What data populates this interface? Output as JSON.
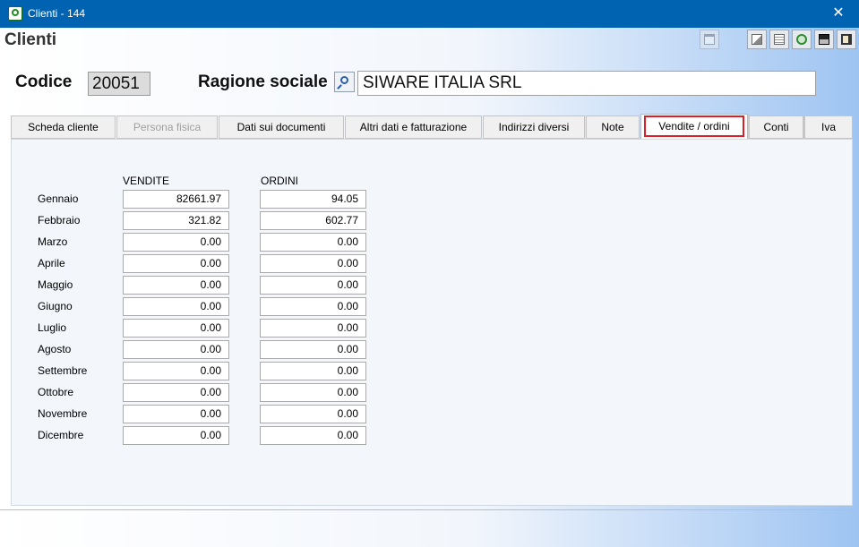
{
  "window": {
    "title": "Clienti - 144",
    "close_glyph": "✕"
  },
  "form": {
    "title": "Clienti"
  },
  "toolbar": {
    "icons": [
      "document-icon",
      "edit-icon",
      "notes-icon",
      "recycle-icon",
      "save-icon",
      "exit-icon"
    ]
  },
  "header": {
    "codice_label": "Codice",
    "codice_value": "20051",
    "ragione_label": "Ragione sociale",
    "ragione_value": "SIWARE ITALIA SRL"
  },
  "tabs": [
    {
      "label": "Scheda cliente",
      "state": "normal"
    },
    {
      "label": "Persona fisica",
      "state": "disabled"
    },
    {
      "label": "Dati sui documenti",
      "state": "normal"
    },
    {
      "label": "Altri dati e fatturazione",
      "state": "normal"
    },
    {
      "label": "Indirizzi diversi",
      "state": "normal"
    },
    {
      "label": "Note",
      "state": "normal"
    },
    {
      "label": "Vendite / ordini",
      "state": "active"
    },
    {
      "label": "Conti",
      "state": "normal"
    },
    {
      "label": "Iva",
      "state": "normal"
    }
  ],
  "sales": {
    "col_vendite": "VENDITE",
    "col_ordini": "ORDINI",
    "rows": [
      {
        "month": "Gennaio",
        "vendite": "82661.97",
        "ordini": "94.05"
      },
      {
        "month": "Febbraio",
        "vendite": "321.82",
        "ordini": "602.77"
      },
      {
        "month": "Marzo",
        "vendite": "0.00",
        "ordini": "0.00"
      },
      {
        "month": "Aprile",
        "vendite": "0.00",
        "ordini": "0.00"
      },
      {
        "month": "Maggio",
        "vendite": "0.00",
        "ordini": "0.00"
      },
      {
        "month": "Giugno",
        "vendite": "0.00",
        "ordini": "0.00"
      },
      {
        "month": "Luglio",
        "vendite": "0.00",
        "ordini": "0.00"
      },
      {
        "month": "Agosto",
        "vendite": "0.00",
        "ordini": "0.00"
      },
      {
        "month": "Settembre",
        "vendite": "0.00",
        "ordini": "0.00"
      },
      {
        "month": "Ottobre",
        "vendite": "0.00",
        "ordini": "0.00"
      },
      {
        "month": "Novembre",
        "vendite": "0.00",
        "ordini": "0.00"
      },
      {
        "month": "Dicembre",
        "vendite": "0.00",
        "ordini": "0.00"
      }
    ]
  },
  "colors": {
    "titlebar": "#0063b1",
    "active_tab_highlight": "#d9202a"
  }
}
